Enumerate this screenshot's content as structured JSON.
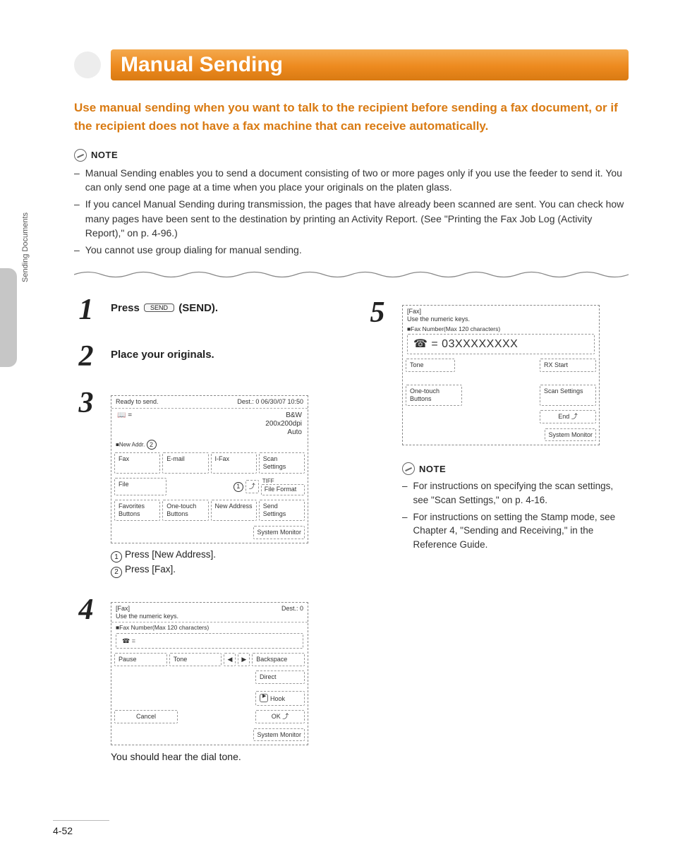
{
  "sideTab": "Sending Documents",
  "title": "Manual Sending",
  "intro": "Use manual sending when you want to talk to the recipient before sending a fax document, or if the recipient does not have a fax machine that can receive automatically.",
  "noteLabel": "NOTE",
  "topNotes": [
    "Manual Sending enables you to send a document consisting of two or more pages only if you use the feeder to send it. You can only send one page at a time when you place your originals on the platen glass.",
    "If you cancel Manual Sending during transmission, the pages that have already been scanned are sent. You can check how many pages have been sent to the destination by printing an Activity Report. (See \"Printing the Fax Job Log (Activity Report),\" on p. 4-96.)",
    "You cannot use group dialing for manual sending."
  ],
  "steps": {
    "s1": {
      "num": "1",
      "prefix": "Press ",
      "key": "SEND",
      "suffix": " (SEND)."
    },
    "s2": {
      "num": "2",
      "text": "Place your originals."
    },
    "s3": {
      "num": "3",
      "screen": {
        "topLeft": "Ready to send.",
        "topRight": "Dest.:   0  06/30/07 10:50",
        "meta1": "B&W",
        "meta2": "200x200dpi",
        "meta3": "Auto",
        "newAddrLabel": "■New Addr.",
        "fax": "Fax",
        "email": "E-mail",
        "ifax": "I-Fax",
        "scanSettings": "Scan Settings",
        "file": "File",
        "tiff": "TIFF",
        "fileFormat": "File Format",
        "favorites": "Favorites Buttons",
        "onetouch": "One-touch Buttons",
        "newAddress": "New Address",
        "sendSettings": "Send Settings",
        "sysmon": "System Monitor"
      },
      "legend1": "Press [New Address].",
      "legend2": "Press [Fax]."
    },
    "s4": {
      "num": "4",
      "screen": {
        "hdr1": "[Fax]",
        "hdr2": "Use the numeric keys.",
        "hdr3": "■Fax Number(Max 120 characters)",
        "topRight": "Dest.:   0",
        "prefix": "☎ =",
        "pause": "Pause",
        "tone": "Tone",
        "backspace": "Backspace",
        "direct": "Direct",
        "hook": "Hook",
        "cancel": "Cancel",
        "ok": "OK",
        "sysmon": "System Monitor"
      },
      "under": "You should hear the dial tone."
    },
    "s5": {
      "num": "5",
      "screen": {
        "hdr1": "[Fax]",
        "hdr2": "Use the numeric keys.",
        "hdr3": "■Fax Number(Max 120 characters)",
        "readout": "☎ = 03XXXXXXXX",
        "tone": "Tone",
        "rxstart": "RX Start",
        "onetouch": "One-touch Buttons",
        "scanSettings": "Scan Settings",
        "end": "End",
        "sysmon": "System Monitor"
      }
    }
  },
  "rightNotes": [
    "For instructions on specifying the scan settings, see \"Scan Settings,\" on p. 4-16.",
    "For instructions on setting the Stamp mode, see Chapter 4, \"Sending and Receiving,\" in the Reference Guide."
  ],
  "pageNumber": "4-52"
}
